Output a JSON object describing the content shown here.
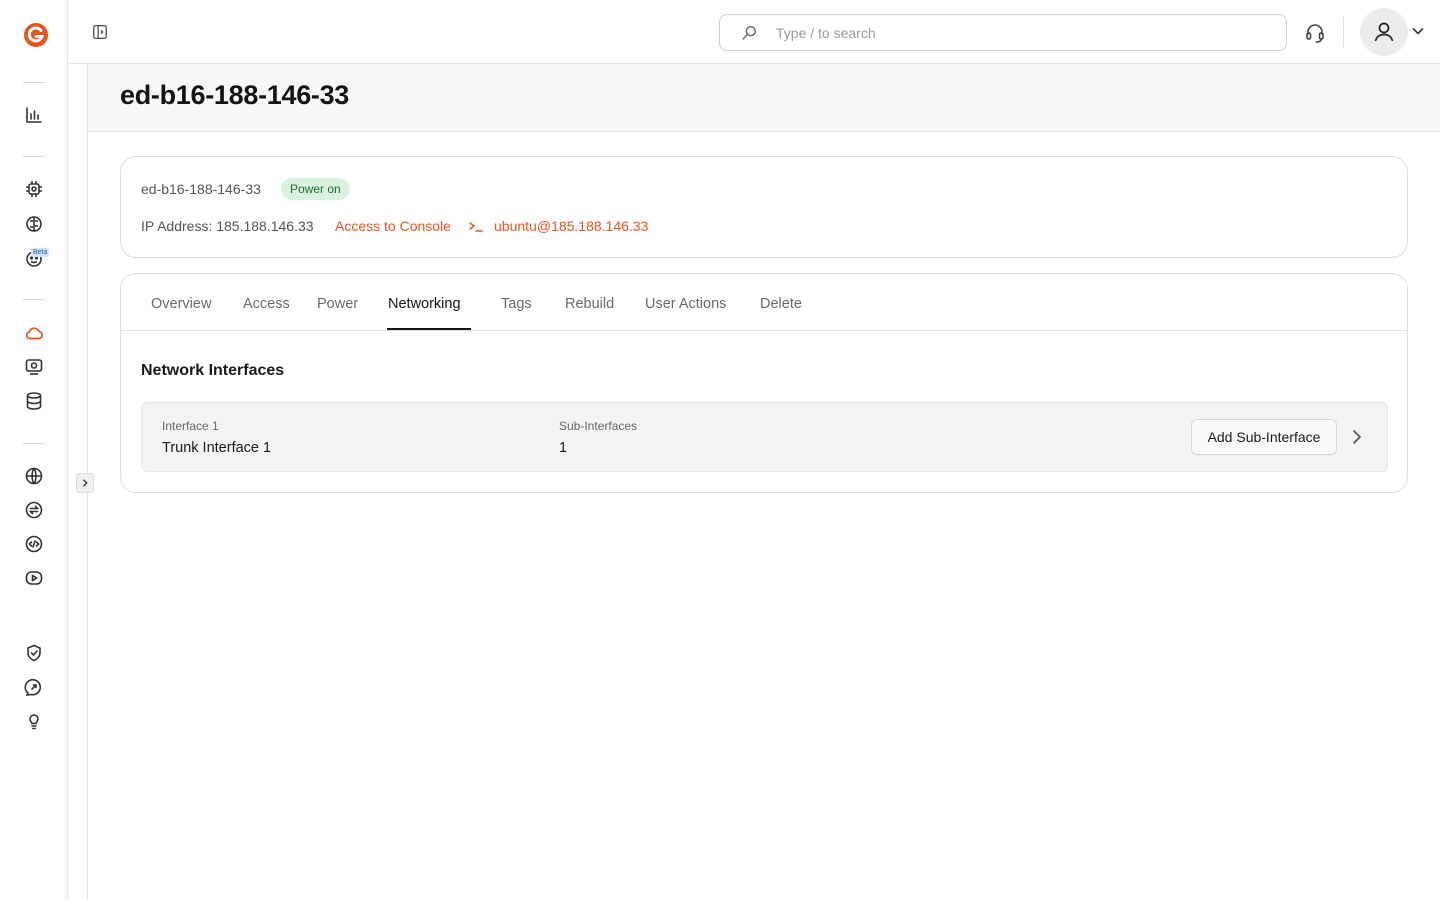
{
  "app": {
    "brand_color": "#e8541c",
    "logo_icon": "g-logo-icon"
  },
  "rail": {
    "icons": [
      "analytics-icon",
      "chip-icon",
      "brain-icon",
      "bot-icon",
      "cloud-icon",
      "monitor-icon",
      "database-icon",
      "globe-icon",
      "exchange-icon",
      "code-icon",
      "media-icon",
      "shield-icon",
      "support-chat-icon",
      "lightbulb-icon"
    ],
    "beta_label": "Beta"
  },
  "topbar": {
    "search_placeholder": "Type / to search"
  },
  "header": {
    "title": "ed-b16-188-146-33"
  },
  "server": {
    "hostname": "ed-b16-188-146-33",
    "status": "Power on",
    "status_color": "#d9f2df",
    "ip_text": "IP Address: 185.188.146.33",
    "console_link": "Access to Console",
    "ssh_link": "ubuntu@185.188.146.33"
  },
  "tabs": [
    {
      "label": "Overview",
      "active": false
    },
    {
      "label": "Access",
      "active": false
    },
    {
      "label": "Power",
      "active": false
    },
    {
      "label": "Networking",
      "active": true
    },
    {
      "label": "Tags",
      "active": false
    },
    {
      "label": "Rebuild",
      "active": false
    },
    {
      "label": "User Actions",
      "active": false
    },
    {
      "label": "Delete",
      "active": false
    }
  ],
  "networking": {
    "section_title": "Network Interfaces",
    "interfaces": [
      {
        "label": "Interface 1",
        "name": "Trunk Interface 1",
        "sub_label": "Sub-Interfaces",
        "sub_count": "1",
        "action_label": "Add Sub-Interface"
      }
    ]
  }
}
